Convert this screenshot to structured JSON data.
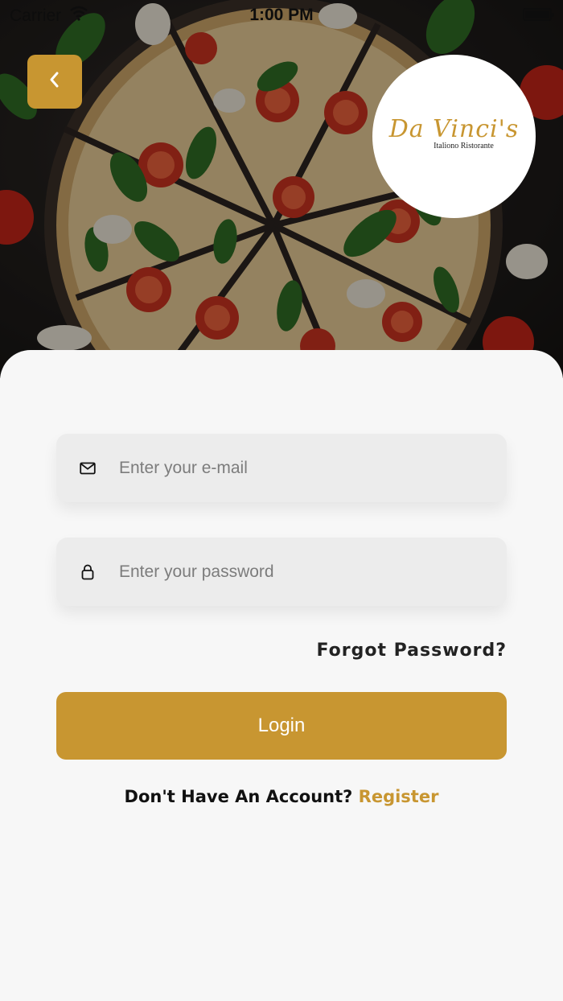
{
  "status_bar": {
    "carrier": "Carrier",
    "time": "1:00 PM"
  },
  "header": {
    "back_icon": "chevron-left-icon",
    "logo": {
      "script": "Da Vinci's",
      "subtitle": "Italiono Ristorante"
    }
  },
  "form": {
    "email": {
      "icon": "mail-icon",
      "placeholder": "Enter your e-mail",
      "value": ""
    },
    "password": {
      "icon": "lock-icon",
      "placeholder": "Enter your password",
      "value": ""
    },
    "forgot_label": "Forgot Password?",
    "login_label": "Login"
  },
  "footer": {
    "question": "Don't Have An Account?",
    "register_label": "Register"
  },
  "colors": {
    "accent": "#c89631",
    "sheet_background": "#f7f7f7",
    "field_background": "#ececec",
    "hero_background": "#1e1b19"
  }
}
